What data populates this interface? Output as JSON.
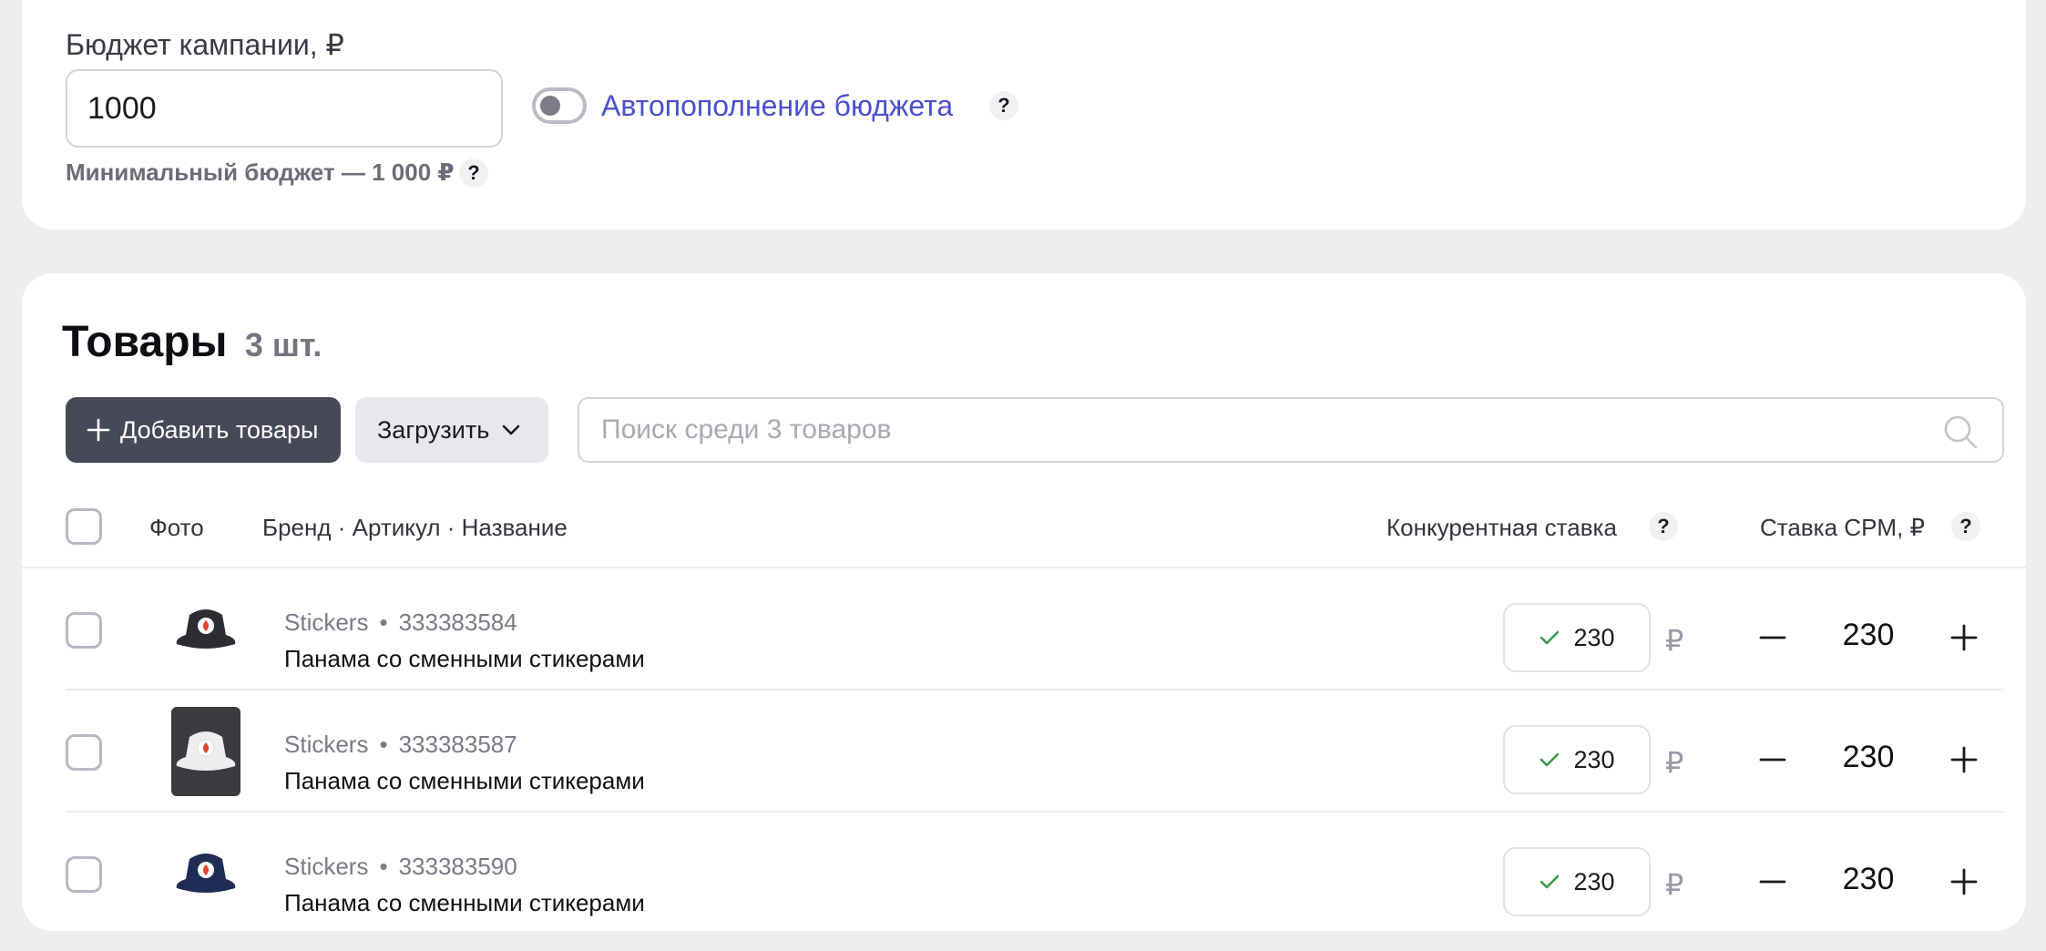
{
  "budget": {
    "label": "Бюджет кампании, ₽",
    "value": "1000",
    "autofill_label": "Автопополнение бюджета",
    "autofill_enabled": false,
    "help_glyph": "?",
    "min_note": "Минимальный бюджет — 1 000 ₽"
  },
  "products": {
    "title": "Товары",
    "count": "3 шт.",
    "add_button": "Добавить товары",
    "upload_button": "Загрузить",
    "search_placeholder": "Поиск среди 3 товаров",
    "columns": {
      "photo": "Фото",
      "name": "Бренд · Артикул · Название",
      "competitive_bid": "Конкурентная ставка",
      "cpm_bid": "Ставка CPM, ₽"
    },
    "currency": "₽",
    "items": [
      {
        "brand": "Stickers",
        "article": "333383584",
        "name": "Панама со сменными стикерами",
        "competitive_bid": "230",
        "cpm": "230",
        "hat_color": "#2b2d33",
        "photo_bg": "#ffffff"
      },
      {
        "brand": "Stickers",
        "article": "333383587",
        "name": "Панама со сменными стикерами",
        "competitive_bid": "230",
        "cpm": "230",
        "hat_color": "#eeeeee",
        "photo_bg": "#3b3b3f"
      },
      {
        "brand": "Stickers",
        "article": "333383590",
        "name": "Панама со сменными стикерами",
        "competitive_bid": "230",
        "cpm": "230",
        "hat_color": "#1f2c55",
        "photo_bg": "#ffffff"
      }
    ]
  },
  "colors": {
    "accent": "#4b4fcf",
    "primary_button": "#474858",
    "check": "#3a9a4a"
  }
}
